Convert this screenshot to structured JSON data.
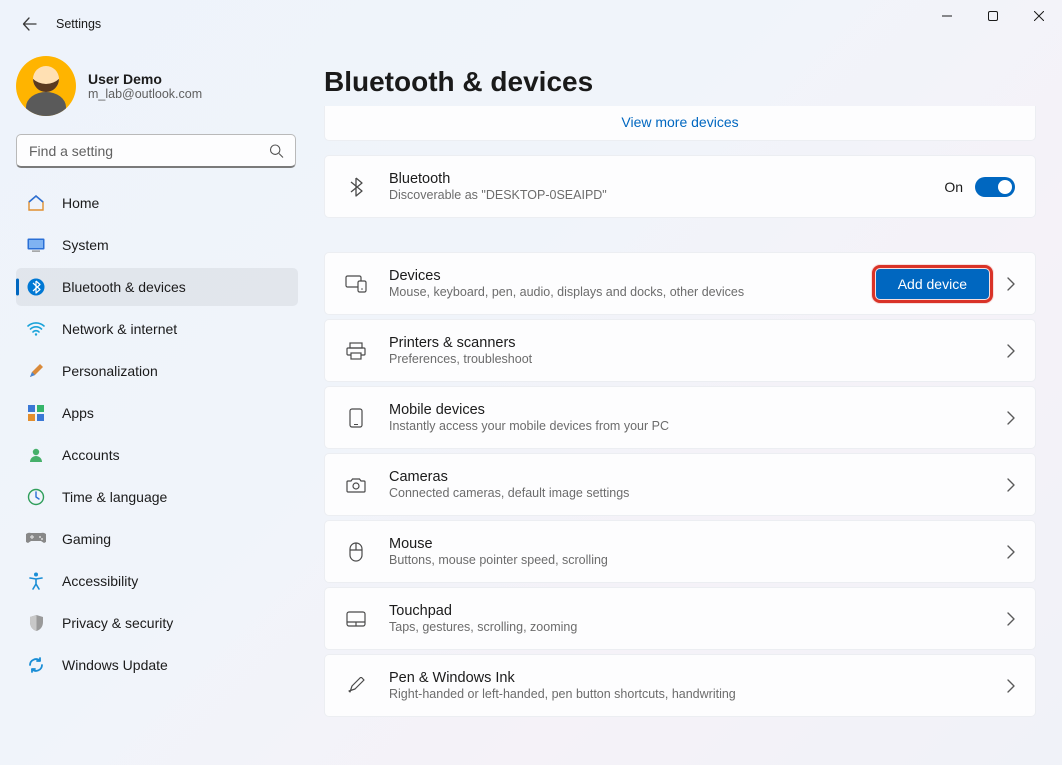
{
  "window": {
    "title": "Settings"
  },
  "user": {
    "name": "User Demo",
    "email": "m_lab@outlook.com"
  },
  "search": {
    "placeholder": "Find a setting"
  },
  "nav": {
    "items": [
      {
        "label": "Home"
      },
      {
        "label": "System"
      },
      {
        "label": "Bluetooth & devices"
      },
      {
        "label": "Network & internet"
      },
      {
        "label": "Personalization"
      },
      {
        "label": "Apps"
      },
      {
        "label": "Accounts"
      },
      {
        "label": "Time & language"
      },
      {
        "label": "Gaming"
      },
      {
        "label": "Accessibility"
      },
      {
        "label": "Privacy & security"
      },
      {
        "label": "Windows Update"
      }
    ],
    "activeIndex": 2
  },
  "page": {
    "title": "Bluetooth & devices",
    "viewMore": "View more devices",
    "bluetooth": {
      "title": "Bluetooth",
      "subtitle": "Discoverable as \"DESKTOP-0SEAIPD\"",
      "stateLabel": "On"
    },
    "addDeviceLabel": "Add device",
    "rows": [
      {
        "title": "Devices",
        "subtitle": "Mouse, keyboard, pen, audio, displays and docks, other devices"
      },
      {
        "title": "Printers & scanners",
        "subtitle": "Preferences, troubleshoot"
      },
      {
        "title": "Mobile devices",
        "subtitle": "Instantly access your mobile devices from your PC"
      },
      {
        "title": "Cameras",
        "subtitle": "Connected cameras, default image settings"
      },
      {
        "title": "Mouse",
        "subtitle": "Buttons, mouse pointer speed, scrolling"
      },
      {
        "title": "Touchpad",
        "subtitle": "Taps, gestures, scrolling, zooming"
      },
      {
        "title": "Pen & Windows Ink",
        "subtitle": "Right-handed or left-handed, pen button shortcuts, handwriting"
      }
    ]
  }
}
